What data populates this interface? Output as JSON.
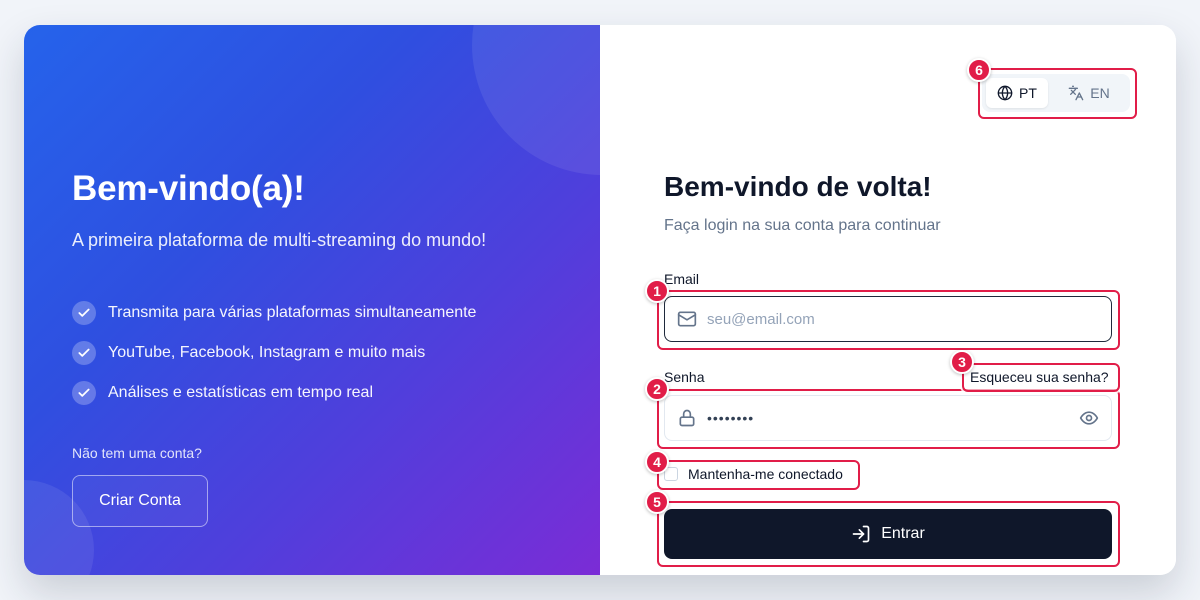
{
  "left": {
    "title": "Bem-vindo(a)!",
    "subtitle": "A primeira plataforma de multi-streaming do mundo!",
    "features": [
      "Transmita para várias plataformas simultaneamente",
      "YouTube, Facebook, Instagram e muito mais",
      "Análises e estatísticas em tempo real"
    ],
    "no_account": "Não tem uma conta?",
    "create_button": "Criar Conta"
  },
  "lang": {
    "pt": "PT",
    "en": "EN",
    "active": "PT"
  },
  "form": {
    "title": "Bem-vindo de volta!",
    "subtitle": "Faça login na sua conta para continuar",
    "email_label": "Email",
    "email_placeholder": "seu@email.com",
    "password_label": "Senha",
    "password_value": "••••••••",
    "forgot": "Esqueceu sua senha?",
    "remember": "Mantenha-me conectado",
    "submit": "Entrar"
  },
  "annotations": [
    "1",
    "2",
    "3",
    "4",
    "5",
    "6"
  ],
  "colors": {
    "gradient_start": "#2563eb",
    "gradient_end": "#7b2cd6",
    "primary_button": "#0f172a",
    "annotation": "#e11d48"
  }
}
